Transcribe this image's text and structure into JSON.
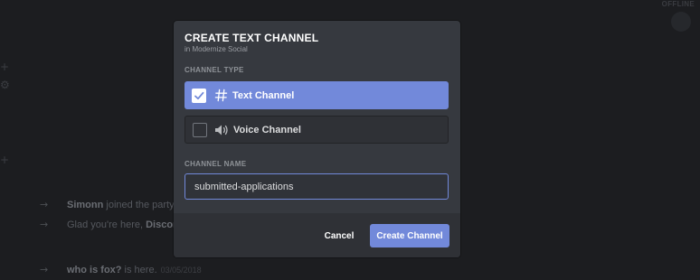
{
  "background": {
    "top_right_label": "OFFLINE",
    "messages": [
      {
        "name": "Simonn",
        "text": " joined the party."
      },
      {
        "name": "",
        "text": "Glad you're here, ",
        "highlight": "Discord"
      },
      {
        "name": "who is fox?",
        "text": " is here.",
        "timestamp": "03/05/2018"
      }
    ]
  },
  "modal": {
    "title": "CREATE TEXT CHANNEL",
    "subtitle": "in Modernize Social",
    "channel_type_label": "CHANNEL TYPE",
    "options": [
      {
        "label": "Text Channel",
        "icon": "hash-icon",
        "selected": true
      },
      {
        "label": "Voice Channel",
        "icon": "speaker-icon",
        "selected": false
      }
    ],
    "channel_name_label": "CHANNEL NAME",
    "channel_name_value": "submitted-applications",
    "cancel_label": "Cancel",
    "create_label": "Create Channel"
  },
  "colors": {
    "accent": "#7289da",
    "modal_bg": "#36393f",
    "footer_bg": "#2f3136",
    "page_bg": "#1c1d20"
  }
}
